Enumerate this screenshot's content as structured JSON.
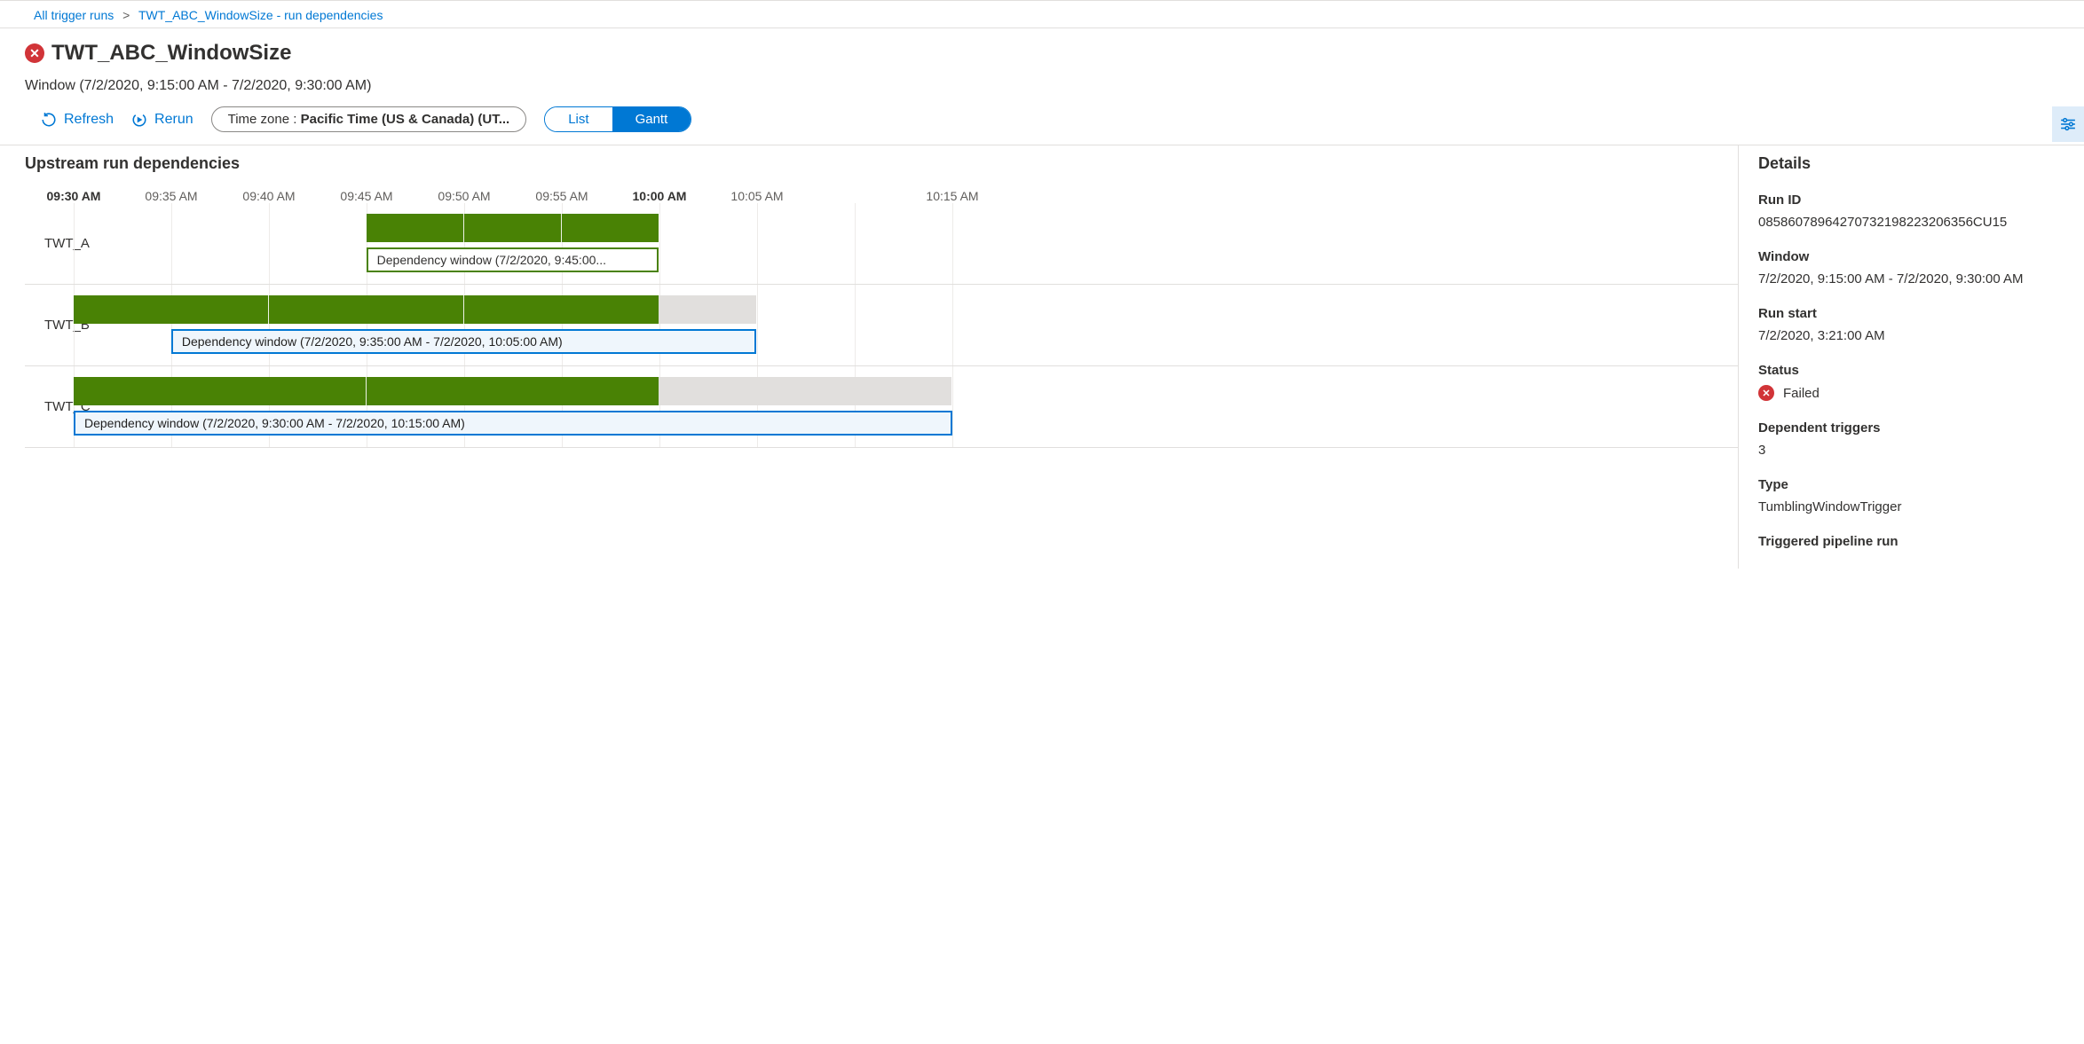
{
  "breadcrumb": {
    "root": "All trigger runs",
    "current": "TWT_ABC_WindowSize - run dependencies"
  },
  "title": "TWT_ABC_WindowSize",
  "title_status": "error",
  "subtitle": "Window (7/2/2020, 9:15:00 AM - 7/2/2020, 9:30:00 AM)",
  "toolbar": {
    "refresh": "Refresh",
    "rerun": "Rerun",
    "timezone_label": "Time zone : ",
    "timezone_value": "Pacific Time (US & Canada) (UT...",
    "view_list": "List",
    "view_gantt": "Gantt",
    "active_view": "Gantt"
  },
  "main_title": "Upstream run dependencies",
  "details_title": "Details",
  "scale": [
    {
      "label": "09:30 AM",
      "bold": true
    },
    {
      "label": "09:35 AM",
      "bold": false
    },
    {
      "label": "09:40 AM",
      "bold": false
    },
    {
      "label": "09:45 AM",
      "bold": false
    },
    {
      "label": "09:50 AM",
      "bold": false
    },
    {
      "label": "09:55 AM",
      "bold": false
    },
    {
      "label": "10:00 AM",
      "bold": true
    },
    {
      "label": "10:05 AM",
      "bold": false
    },
    {
      "label": "",
      "bold": false
    },
    {
      "label": "10:15 AM",
      "bold": false
    }
  ],
  "rows": [
    {
      "name": "TWT_A",
      "bar": {
        "start_pct": 33.3,
        "width_pct": 33.3,
        "segments": 3,
        "grey_width_pct": 0
      },
      "dep": {
        "style": "green",
        "start_pct": 33.3,
        "width_pct": 33.3,
        "label": "Dependency window (7/2/2020, 9:45:00..."
      }
    },
    {
      "name": "TWT_B",
      "bar": {
        "start_pct": 0,
        "width_pct": 66.6,
        "segments": 3,
        "grey_width_pct": 11.1
      },
      "dep": {
        "style": "blue",
        "start_pct": 11.1,
        "width_pct": 66.6,
        "label": "Dependency window (7/2/2020, 9:35:00 AM - 7/2/2020, 10:05:00 AM)"
      }
    },
    {
      "name": "TWT_C",
      "bar": {
        "start_pct": 0,
        "width_pct": 66.6,
        "segments": 2,
        "grey_width_pct": 33.3
      },
      "dep": {
        "style": "blue",
        "start_pct": 0,
        "width_pct": 100,
        "label": "Dependency window (7/2/2020, 9:30:00 AM - 7/2/2020, 10:15:00 AM)"
      }
    }
  ],
  "details": {
    "run_id": {
      "label": "Run ID",
      "value": "08586078964270732198223206356CU15"
    },
    "window": {
      "label": "Window",
      "value": "7/2/2020, 9:15:00 AM - 7/2/2020, 9:30:00 AM"
    },
    "run_start": {
      "label": "Run start",
      "value": "7/2/2020, 3:21:00 AM"
    },
    "status": {
      "label": "Status",
      "value": "Failed"
    },
    "dependent": {
      "label": "Dependent triggers",
      "value": "3"
    },
    "type": {
      "label": "Type",
      "value": "TumblingWindowTrigger"
    },
    "pipeline": {
      "label": "Triggered pipeline run",
      "value": ""
    }
  }
}
